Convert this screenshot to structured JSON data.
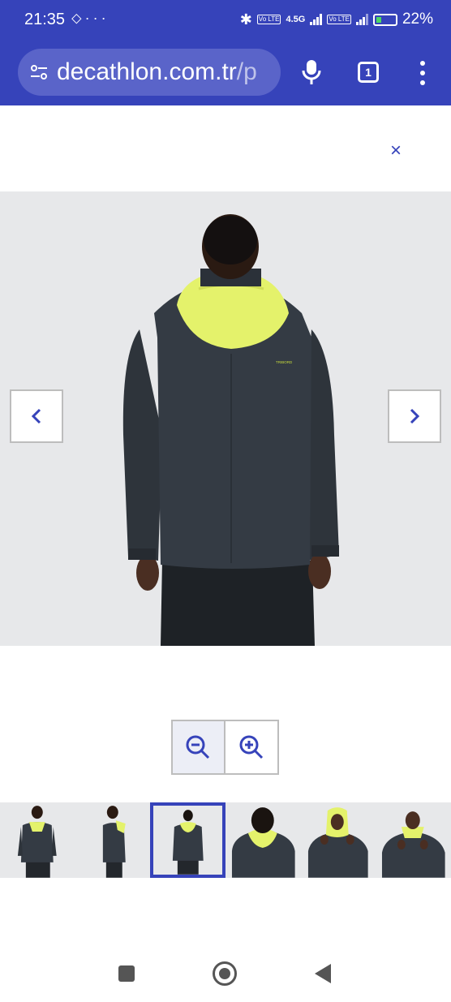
{
  "status_bar": {
    "time": "21:35",
    "left_icons": [
      "navigation-icon",
      "more-icon"
    ],
    "network_1": "4.5G",
    "volte_1": "Vo LTE",
    "volte_2": "Vo LTE",
    "battery": "22%"
  },
  "browser": {
    "url_host": "decathlon.com.tr",
    "url_rest": "/p",
    "tab_count": "1"
  },
  "viewer": {
    "close_label": "×",
    "prev_label": "previous-image",
    "next_label": "next-image",
    "chest_logo": "TRIBORD"
  },
  "zoom": {
    "out_label": "zoom-out",
    "in_label": "zoom-in"
  },
  "thumbnails": {
    "count": 6,
    "active_index": 2
  },
  "colors": {
    "brand": "#3643ba",
    "jacket": "#343b44",
    "hood": "#e4f26b"
  }
}
